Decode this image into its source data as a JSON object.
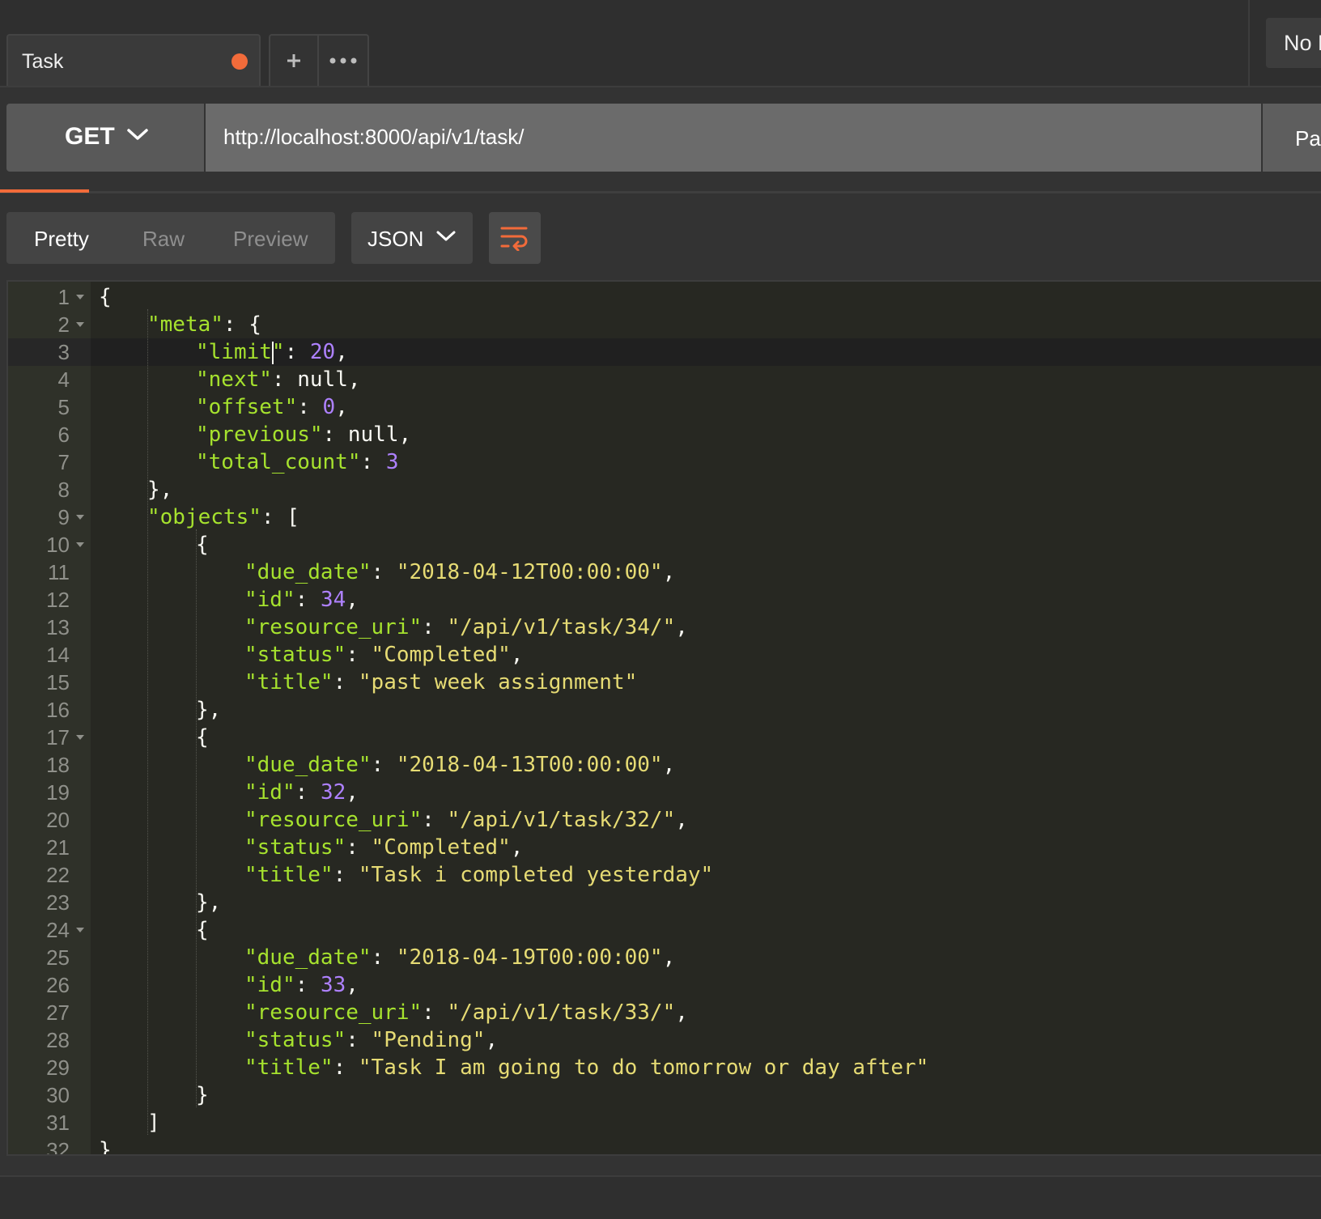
{
  "tabs": [
    {
      "title": "Task",
      "unsaved": true
    }
  ],
  "tab_actions": {
    "add_icon": "plus-icon",
    "more_icon": "more-icon"
  },
  "environment": {
    "label": "No Environment"
  },
  "request": {
    "method": "GET",
    "url": "http://localhost:8000/api/v1/task/",
    "params_label": "Params"
  },
  "response_toolbar": {
    "view_tabs": [
      "Pretty",
      "Raw",
      "Preview"
    ],
    "active_view": "Pretty",
    "format": "JSON",
    "wrap_icon": "wrap-lines-icon"
  },
  "editor": {
    "active_line": 3,
    "lines": [
      {
        "n": "1",
        "fold": true,
        "indent": 0,
        "tokens": [
          {
            "t": "{",
            "c": "p"
          }
        ]
      },
      {
        "n": "2",
        "fold": true,
        "indent": 1,
        "tokens": [
          {
            "t": "\"meta\"",
            "c": "k"
          },
          {
            "t": ": {",
            "c": "p"
          }
        ]
      },
      {
        "n": "3",
        "fold": false,
        "indent": 2,
        "tokens": [
          {
            "t": "\"limit\"",
            "c": "k"
          },
          {
            "t": ": ",
            "c": "p"
          },
          {
            "t": "20",
            "c": "n"
          },
          {
            "t": ",",
            "c": "p"
          }
        ]
      },
      {
        "n": "4",
        "fold": false,
        "indent": 2,
        "tokens": [
          {
            "t": "\"next\"",
            "c": "k"
          },
          {
            "t": ": null,",
            "c": "p"
          }
        ]
      },
      {
        "n": "5",
        "fold": false,
        "indent": 2,
        "tokens": [
          {
            "t": "\"offset\"",
            "c": "k"
          },
          {
            "t": ": ",
            "c": "p"
          },
          {
            "t": "0",
            "c": "n"
          },
          {
            "t": ",",
            "c": "p"
          }
        ]
      },
      {
        "n": "6",
        "fold": false,
        "indent": 2,
        "tokens": [
          {
            "t": "\"previous\"",
            "c": "k"
          },
          {
            "t": ": null,",
            "c": "p"
          }
        ]
      },
      {
        "n": "7",
        "fold": false,
        "indent": 2,
        "tokens": [
          {
            "t": "\"total_count\"",
            "c": "k"
          },
          {
            "t": ": ",
            "c": "p"
          },
          {
            "t": "3",
            "c": "n"
          }
        ]
      },
      {
        "n": "8",
        "fold": false,
        "indent": 1,
        "tokens": [
          {
            "t": "},",
            "c": "p"
          }
        ]
      },
      {
        "n": "9",
        "fold": true,
        "indent": 1,
        "tokens": [
          {
            "t": "\"objects\"",
            "c": "k"
          },
          {
            "t": ": [",
            "c": "p"
          }
        ]
      },
      {
        "n": "10",
        "fold": true,
        "indent": 2,
        "tokens": [
          {
            "t": "{",
            "c": "p"
          }
        ]
      },
      {
        "n": "11",
        "fold": false,
        "indent": 3,
        "tokens": [
          {
            "t": "\"due_date\"",
            "c": "k"
          },
          {
            "t": ": ",
            "c": "p"
          },
          {
            "t": "\"2018-04-12T00:00:00\"",
            "c": "s"
          },
          {
            "t": ",",
            "c": "p"
          }
        ]
      },
      {
        "n": "12",
        "fold": false,
        "indent": 3,
        "tokens": [
          {
            "t": "\"id\"",
            "c": "k"
          },
          {
            "t": ": ",
            "c": "p"
          },
          {
            "t": "34",
            "c": "n"
          },
          {
            "t": ",",
            "c": "p"
          }
        ]
      },
      {
        "n": "13",
        "fold": false,
        "indent": 3,
        "tokens": [
          {
            "t": "\"resource_uri\"",
            "c": "k"
          },
          {
            "t": ": ",
            "c": "p"
          },
          {
            "t": "\"/api/v1/task/34/\"",
            "c": "s"
          },
          {
            "t": ",",
            "c": "p"
          }
        ]
      },
      {
        "n": "14",
        "fold": false,
        "indent": 3,
        "tokens": [
          {
            "t": "\"status\"",
            "c": "k"
          },
          {
            "t": ": ",
            "c": "p"
          },
          {
            "t": "\"Completed\"",
            "c": "s"
          },
          {
            "t": ",",
            "c": "p"
          }
        ]
      },
      {
        "n": "15",
        "fold": false,
        "indent": 3,
        "tokens": [
          {
            "t": "\"title\"",
            "c": "k"
          },
          {
            "t": ": ",
            "c": "p"
          },
          {
            "t": "\"past week assignment\"",
            "c": "s"
          }
        ]
      },
      {
        "n": "16",
        "fold": false,
        "indent": 2,
        "tokens": [
          {
            "t": "},",
            "c": "p"
          }
        ]
      },
      {
        "n": "17",
        "fold": true,
        "indent": 2,
        "tokens": [
          {
            "t": "{",
            "c": "p"
          }
        ]
      },
      {
        "n": "18",
        "fold": false,
        "indent": 3,
        "tokens": [
          {
            "t": "\"due_date\"",
            "c": "k"
          },
          {
            "t": ": ",
            "c": "p"
          },
          {
            "t": "\"2018-04-13T00:00:00\"",
            "c": "s"
          },
          {
            "t": ",",
            "c": "p"
          }
        ]
      },
      {
        "n": "19",
        "fold": false,
        "indent": 3,
        "tokens": [
          {
            "t": "\"id\"",
            "c": "k"
          },
          {
            "t": ": ",
            "c": "p"
          },
          {
            "t": "32",
            "c": "n"
          },
          {
            "t": ",",
            "c": "p"
          }
        ]
      },
      {
        "n": "20",
        "fold": false,
        "indent": 3,
        "tokens": [
          {
            "t": "\"resource_uri\"",
            "c": "k"
          },
          {
            "t": ": ",
            "c": "p"
          },
          {
            "t": "\"/api/v1/task/32/\"",
            "c": "s"
          },
          {
            "t": ",",
            "c": "p"
          }
        ]
      },
      {
        "n": "21",
        "fold": false,
        "indent": 3,
        "tokens": [
          {
            "t": "\"status\"",
            "c": "k"
          },
          {
            "t": ": ",
            "c": "p"
          },
          {
            "t": "\"Completed\"",
            "c": "s"
          },
          {
            "t": ",",
            "c": "p"
          }
        ]
      },
      {
        "n": "22",
        "fold": false,
        "indent": 3,
        "tokens": [
          {
            "t": "\"title\"",
            "c": "k"
          },
          {
            "t": ": ",
            "c": "p"
          },
          {
            "t": "\"Task i completed yesterday\"",
            "c": "s"
          }
        ]
      },
      {
        "n": "23",
        "fold": false,
        "indent": 2,
        "tokens": [
          {
            "t": "},",
            "c": "p"
          }
        ]
      },
      {
        "n": "24",
        "fold": true,
        "indent": 2,
        "tokens": [
          {
            "t": "{",
            "c": "p"
          }
        ]
      },
      {
        "n": "25",
        "fold": false,
        "indent": 3,
        "tokens": [
          {
            "t": "\"due_date\"",
            "c": "k"
          },
          {
            "t": ": ",
            "c": "p"
          },
          {
            "t": "\"2018-04-19T00:00:00\"",
            "c": "s"
          },
          {
            "t": ",",
            "c": "p"
          }
        ]
      },
      {
        "n": "26",
        "fold": false,
        "indent": 3,
        "tokens": [
          {
            "t": "\"id\"",
            "c": "k"
          },
          {
            "t": ": ",
            "c": "p"
          },
          {
            "t": "33",
            "c": "n"
          },
          {
            "t": ",",
            "c": "p"
          }
        ]
      },
      {
        "n": "27",
        "fold": false,
        "indent": 3,
        "tokens": [
          {
            "t": "\"resource_uri\"",
            "c": "k"
          },
          {
            "t": ": ",
            "c": "p"
          },
          {
            "t": "\"/api/v1/task/33/\"",
            "c": "s"
          },
          {
            "t": ",",
            "c": "p"
          }
        ]
      },
      {
        "n": "28",
        "fold": false,
        "indent": 3,
        "tokens": [
          {
            "t": "\"status\"",
            "c": "k"
          },
          {
            "t": ": ",
            "c": "p"
          },
          {
            "t": "\"Pending\"",
            "c": "s"
          },
          {
            "t": ",",
            "c": "p"
          }
        ]
      },
      {
        "n": "29",
        "fold": false,
        "indent": 3,
        "tokens": [
          {
            "t": "\"title\"",
            "c": "k"
          },
          {
            "t": ": ",
            "c": "p"
          },
          {
            "t": "\"Task I am going to do tomorrow or day after\"",
            "c": "s"
          }
        ]
      },
      {
        "n": "30",
        "fold": false,
        "indent": 2,
        "tokens": [
          {
            "t": "}",
            "c": "p"
          }
        ]
      },
      {
        "n": "31",
        "fold": false,
        "indent": 1,
        "tokens": [
          {
            "t": "]",
            "c": "p"
          }
        ]
      },
      {
        "n": "32",
        "fold": false,
        "indent": 0,
        "tokens": [
          {
            "t": "}",
            "c": "p"
          }
        ]
      }
    ]
  },
  "colors": {
    "accent": "#f26b3a",
    "editor_bg": "#272822",
    "key": "#a6e22e",
    "string": "#e6db74",
    "number": "#ae81ff"
  }
}
